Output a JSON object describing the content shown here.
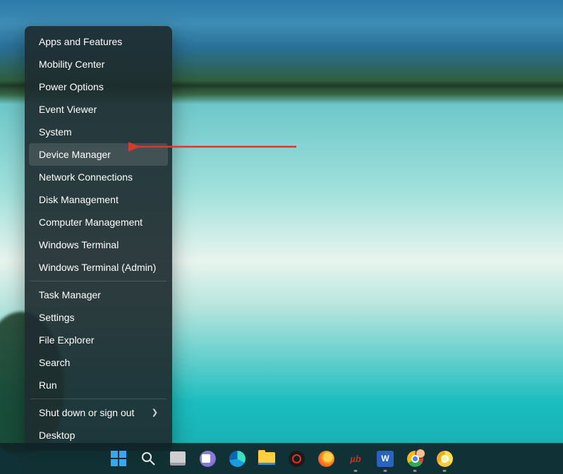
{
  "menu": {
    "items": [
      {
        "label": "Apps and Features",
        "name": "menu-apps-features"
      },
      {
        "label": "Mobility Center",
        "name": "menu-mobility-center"
      },
      {
        "label": "Power Options",
        "name": "menu-power-options"
      },
      {
        "label": "Event Viewer",
        "name": "menu-event-viewer"
      },
      {
        "label": "System",
        "name": "menu-system"
      },
      {
        "label": "Device Manager",
        "name": "menu-device-manager",
        "highlighted": true
      },
      {
        "label": "Network Connections",
        "name": "menu-network-connections"
      },
      {
        "label": "Disk Management",
        "name": "menu-disk-management"
      },
      {
        "label": "Computer Management",
        "name": "menu-computer-management"
      },
      {
        "label": "Windows Terminal",
        "name": "menu-windows-terminal"
      },
      {
        "label": "Windows Terminal (Admin)",
        "name": "menu-windows-terminal-admin"
      },
      {
        "separator": true
      },
      {
        "label": "Task Manager",
        "name": "menu-task-manager"
      },
      {
        "label": "Settings",
        "name": "menu-settings"
      },
      {
        "label": "File Explorer",
        "name": "menu-file-explorer"
      },
      {
        "label": "Search",
        "name": "menu-search"
      },
      {
        "label": "Run",
        "name": "menu-run"
      },
      {
        "separator": true
      },
      {
        "label": "Shut down or sign out",
        "name": "menu-shutdown-signout",
        "submenu": true
      },
      {
        "label": "Desktop",
        "name": "menu-desktop"
      }
    ]
  },
  "annotation_arrow_color": "#d73a2d",
  "taskbar": {
    "items": [
      {
        "name": "start-button",
        "type": "start"
      },
      {
        "name": "search-button",
        "type": "search"
      },
      {
        "name": "task-view-button",
        "type": "taskview"
      },
      {
        "name": "teams-chat-button",
        "type": "teams"
      },
      {
        "name": "edge-button",
        "type": "edge"
      },
      {
        "name": "file-explorer-button",
        "type": "folder"
      },
      {
        "name": "opera-button",
        "type": "opera"
      },
      {
        "name": "firefox-button",
        "type": "firefox"
      },
      {
        "name": "ublock-button",
        "type": "mublock",
        "text": "µb",
        "running": true
      },
      {
        "name": "word-button",
        "type": "word",
        "text": "W",
        "running": true
      },
      {
        "name": "chrome-button",
        "type": "chrome",
        "running": true,
        "avatar": true
      },
      {
        "name": "chrome-canary-button",
        "type": "canary",
        "running": true
      }
    ]
  }
}
